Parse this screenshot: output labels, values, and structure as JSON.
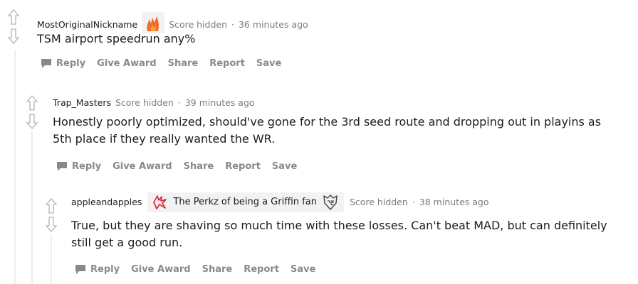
{
  "comments": [
    {
      "author": "MostOriginalNickname",
      "score": "Score hidden",
      "separator": "·",
      "time": "36 minutes ago",
      "body": "TSM airport speedrun any%",
      "flair_icon": "flame-flair-icon"
    },
    {
      "author": "Trap_Masters",
      "score": "Score hidden",
      "separator": "·",
      "time": "39 minutes ago",
      "body": "Honestly poorly optimized, should've gone for the 3rd seed route and dropping out in playins as 5th place if they really wanted the WR."
    },
    {
      "author": "appleandapples",
      "flair_text": "The Perkz of being a Griffin fan",
      "score": "Score hidden",
      "separator": "·",
      "time": "38 minutes ago",
      "body": "True, but they are shaving so much time with these losses. Can't beat MAD, but can definitely still get a good run."
    }
  ],
  "actions": {
    "reply": "Reply",
    "give_award": "Give Award",
    "share": "Share",
    "report": "Report",
    "save": "Save"
  },
  "colors": {
    "meta_gray": "#7c7c7c",
    "action_gray": "#878a8c",
    "thread_line": "#edeff1",
    "flair_bg": "#f2f2f2",
    "flame": "#f26c2a"
  }
}
